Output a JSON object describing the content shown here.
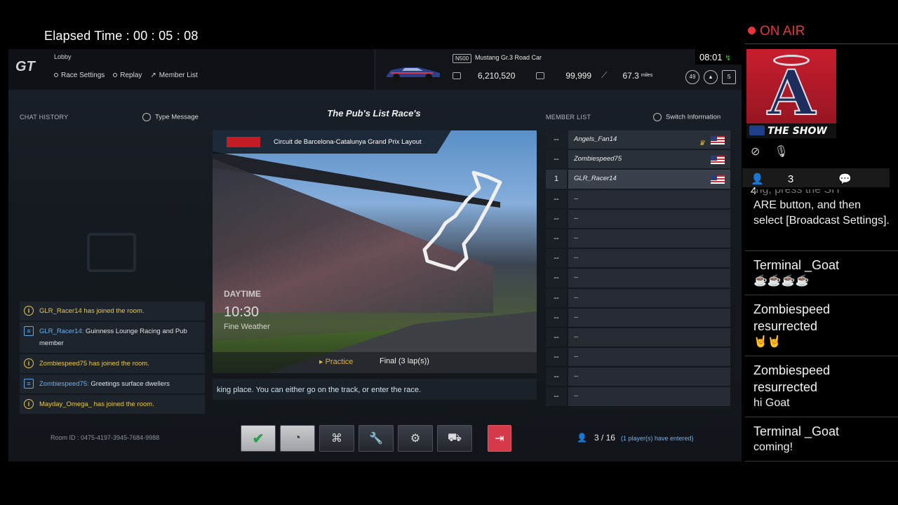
{
  "elapsed": "Elapsed Time : 00 : 05 : 08",
  "top": {
    "screen": "Lobby",
    "nav": [
      "Race Settings",
      "Replay",
      "Member List"
    ],
    "car_badge": "N500",
    "car_name": "Mustang Gr.3 Road Car",
    "credits": "6,210,520",
    "mileage_points": "99,999",
    "distance": "67.3",
    "distance_unit": "miles",
    "level": "49",
    "clock": "08:01"
  },
  "chat": {
    "header": "CHAT HISTORY",
    "type_label": "Type Message",
    "messages": [
      {
        "kind": "system",
        "user": "GLR_Racer14",
        "text": " has joined the room."
      },
      {
        "kind": "user",
        "user": "GLR_Racer14:",
        "text": " Guinness Lounge Racing and Pub member"
      },
      {
        "kind": "system",
        "user": "Zombiespeed75",
        "text": " has joined the room."
      },
      {
        "kind": "user",
        "user": "Zombiespeed75:",
        "text": " Greetings surface dwellers"
      },
      {
        "kind": "system",
        "user": "Mayday_Omega_",
        "text": " has joined the room."
      }
    ]
  },
  "race": {
    "title": "The Pub's List Race's",
    "track": "Circuit de Barcelona-Catalunya Grand Prix Layout",
    "daytime_label": "DAYTIME",
    "time": "10:30",
    "weather": "Fine Weather",
    "mode_practice": "Practice",
    "mode_final": "Final (3 lap(s))",
    "ticker": "king place. You can either go on the track, or enter the race."
  },
  "room_id": "Room ID  : 0475-4197-3945-7684-9988",
  "members": {
    "header": "MEMBER LIST",
    "switch_label": "Switch Information",
    "rows": [
      {
        "rank": "--",
        "name": "Angels_Fan14",
        "flag": true,
        "crown": true
      },
      {
        "rank": "--",
        "name": "Zombiespeed75",
        "flag": true,
        "crown": false
      },
      {
        "rank": "1",
        "name": "GLR_Racer14",
        "flag": true,
        "crown": false
      },
      {
        "rank": "--",
        "name": "--"
      },
      {
        "rank": "--",
        "name": "--"
      },
      {
        "rank": "--",
        "name": "--"
      },
      {
        "rank": "--",
        "name": "--"
      },
      {
        "rank": "--",
        "name": "--"
      },
      {
        "rank": "--",
        "name": "--"
      },
      {
        "rank": "--",
        "name": "--"
      },
      {
        "rank": "--",
        "name": "--"
      },
      {
        "rank": "--",
        "name": "--"
      },
      {
        "rank": "--",
        "name": "--"
      },
      {
        "rank": "--",
        "name": "--"
      }
    ]
  },
  "players": {
    "count": "3 / 16",
    "entered": "(1 player(s) have entered)"
  },
  "stream": {
    "onair": "ON AIR",
    "game_title": "THE SHOW",
    "viewers": "3",
    "comments_count": "4",
    "partial_cut": "ing, press the SH",
    "partial_text": "ARE button, and then select [Broadcast Settings].",
    "comments": [
      {
        "user": "Terminal _Goat",
        "text": "☕☕☕☕"
      },
      {
        "user": "Zombiespeed resurrected",
        "text": "🤘🤘"
      },
      {
        "user": "Zombiespeed resurrected",
        "text": "hi Goat"
      },
      {
        "user": "Terminal _Goat",
        "text": "coming!"
      }
    ]
  }
}
